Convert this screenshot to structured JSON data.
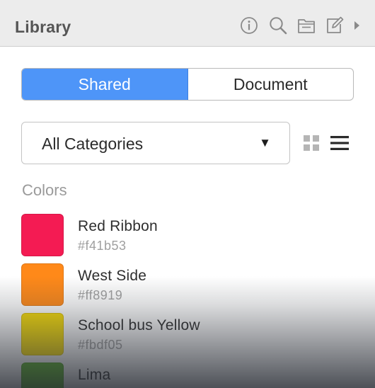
{
  "header": {
    "title": "Library",
    "icons": [
      "info-icon",
      "search-icon",
      "folder-icon",
      "edit-icon",
      "chevron-right-icon"
    ]
  },
  "segmented": {
    "shared_label": "Shared",
    "document_label": "Document",
    "active": "Shared"
  },
  "category_select": {
    "value": "All Categories",
    "arrow": "▼"
  },
  "view_toggle": [
    "grid-view-icon",
    "list-view-icon"
  ],
  "colors_section": {
    "title": "Colors",
    "items": [
      {
        "name": "Red Ribbon",
        "hex": "#f41b53",
        "color": "#f41b53"
      },
      {
        "name": "West Side",
        "hex": "#ff8919",
        "color": "#ff8919"
      },
      {
        "name": "School bus Yellow",
        "hex": "#fbdf05",
        "color": "#fbdf05"
      },
      {
        "name": "Lima",
        "color": "#5cb82a"
      }
    ]
  },
  "accent_color": "#4e95f8"
}
